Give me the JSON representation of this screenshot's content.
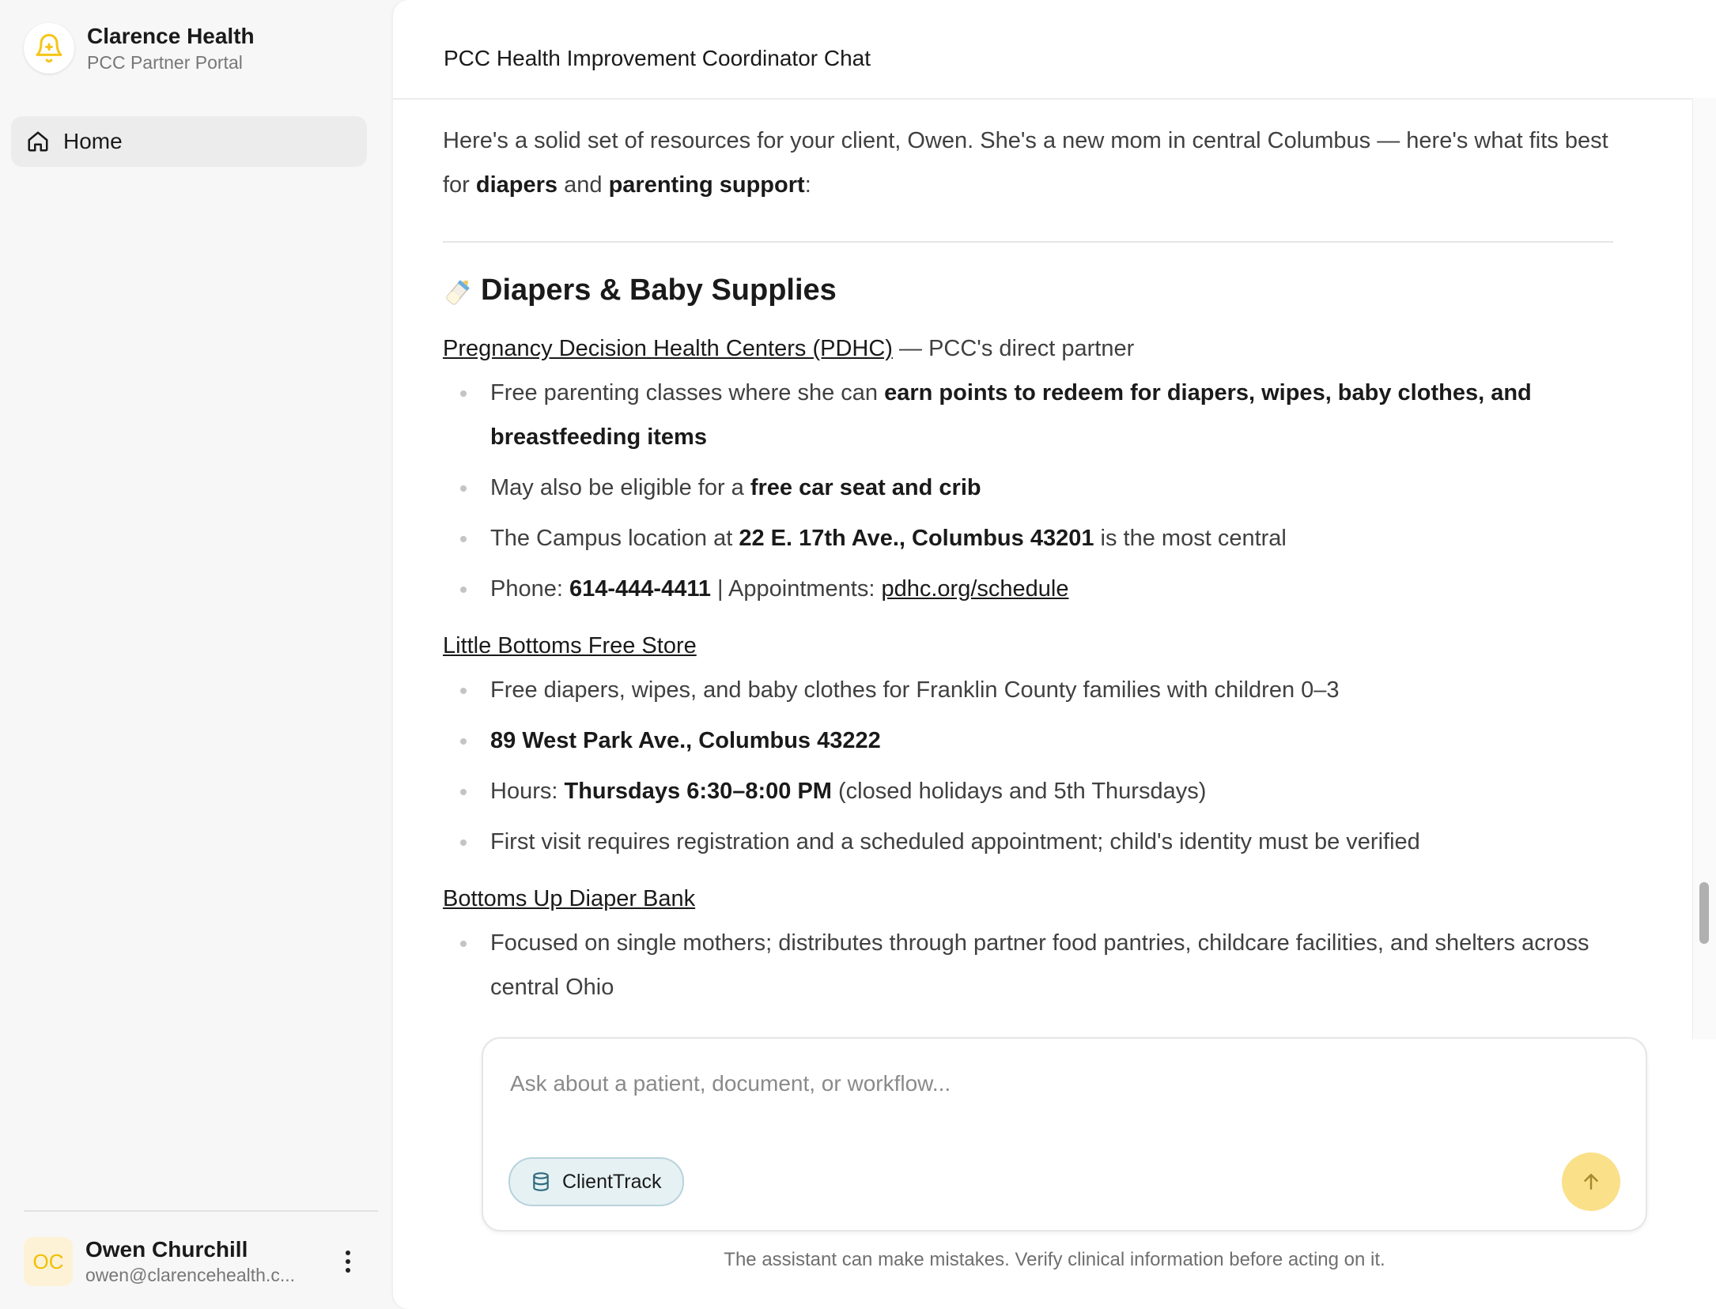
{
  "sidebar": {
    "brand_name": "Clarence Health",
    "brand_subtitle": "PCC Partner Portal",
    "nav": [
      {
        "label": "Home",
        "icon": "home-icon"
      }
    ],
    "user": {
      "initials": "OC",
      "name": "Owen Churchill",
      "email": "owen@clarencehealth.c..."
    }
  },
  "header": {
    "title": "PCC Health Improvement Coordinator Chat"
  },
  "message": {
    "intro_1": "Here's a solid set of resources for your client, Owen. She's a new mom in central Columbus — here's what fits best for ",
    "intro_bold_1": "diapers",
    "intro_2": " and ",
    "intro_bold_2": "parenting support",
    "intro_3": ":",
    "section_emoji": "baby-bottle-icon",
    "section_title": "Diapers & Baby Supplies",
    "orgs": [
      {
        "name": "Pregnancy Decision Health Centers (PDHC)",
        "note": " — PCC's direct partner",
        "b1_a": "Free parenting classes where she can ",
        "b1_b": "earn points to redeem for diapers, wipes, baby clothes, and breastfeeding items",
        "b2_a": "May also be eligible for a ",
        "b2_b": "free car seat and crib",
        "b3_a": "The Campus location at ",
        "b3_b": "22 E. 17th Ave., Columbus 43201",
        "b3_c": " is the most central",
        "b4_a": "Phone: ",
        "b4_b": "614-444-4411",
        "b4_c": " | Appointments: ",
        "b4_link": "pdhc.org/schedule"
      },
      {
        "name": "Little Bottoms Free Store",
        "b1": "Free diapers, wipes, and baby clothes for Franklin County families with children 0–3",
        "b2": "89 West Park Ave., Columbus 43222",
        "b3_a": "Hours: ",
        "b3_b": "Thursdays 6:30–8:00 PM",
        "b3_c": " (closed holidays and 5th Thursdays)",
        "b4": "First visit requires registration and a scheduled appointment; child's identity must be verified"
      },
      {
        "name": "Bottoms Up Diaper Bank",
        "b1": "Focused on single mothers; distributes through partner food pantries, childcare facilities, and shelters across central Ohio"
      }
    ]
  },
  "composer": {
    "placeholder": "Ask about a patient, document, or workflow...",
    "chip_label": "ClientTrack",
    "chip_icon": "database-icon",
    "send_icon": "arrow-up-icon"
  },
  "disclaimer": "The assistant can make mistakes. Verify clinical information before acting on it.",
  "colors": {
    "accent": "#f5c518",
    "send_button": "#fbe08a",
    "chip_bg": "#e6f1f4",
    "chip_border": "#b8d3dc"
  }
}
